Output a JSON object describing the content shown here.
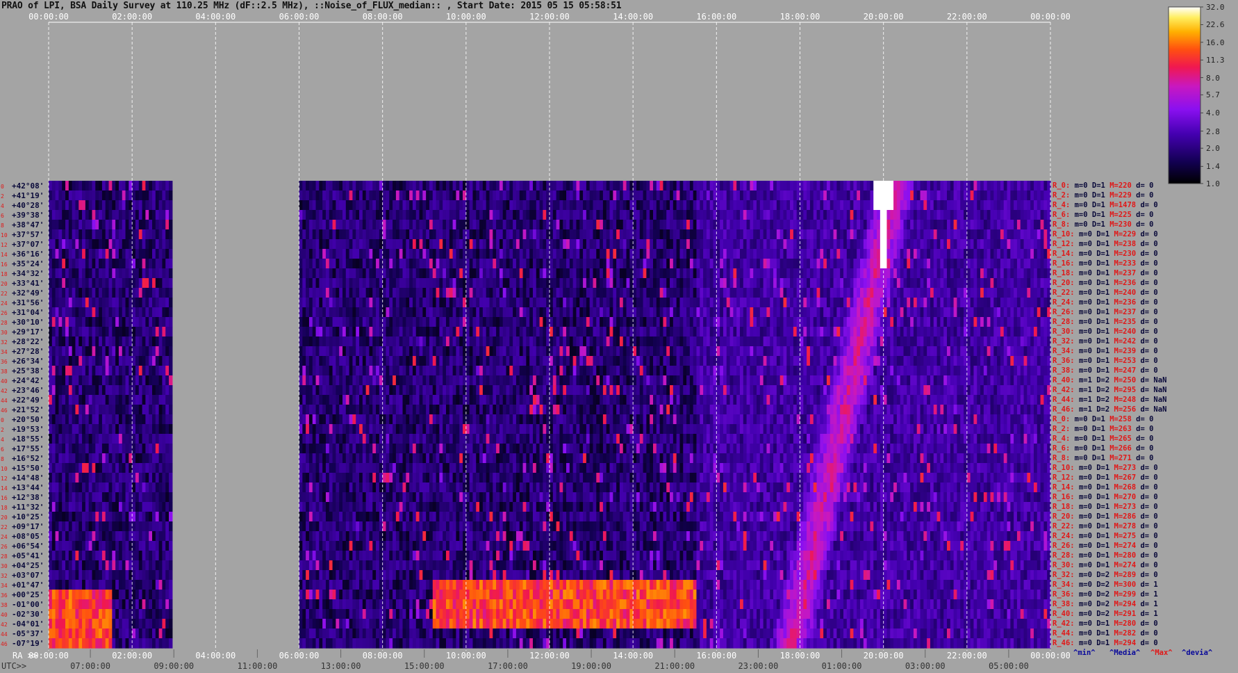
{
  "page": {
    "title": "PRAO of LPI, BSA Daily Survey at 110.25 MHz (dF::2.5 MHz), ::Noise_of_FLUX_median:: , Start Date: 2015 05 15 05:58:51"
  },
  "chart_data": {
    "type": "heatmap",
    "x_axis_top": {
      "label": "",
      "ticks": [
        "00:00:00",
        "02:00:00",
        "04:00:00",
        "06:00:00",
        "08:00:00",
        "10:00:00",
        "12:00:00",
        "14:00:00",
        "16:00:00",
        "18:00:00",
        "20:00:00",
        "22:00:00",
        "00:00:00"
      ]
    },
    "x_axis_ra": {
      "label": "RA >>",
      "ticks": [
        "00:00:00",
        "02:00:00",
        "04:00:00",
        "06:00:00",
        "08:00:00",
        "10:00:00",
        "12:00:00",
        "14:00:00",
        "16:00:00",
        "18:00:00",
        "20:00:00",
        "22:00:00",
        "00:00:00"
      ]
    },
    "x_axis_utc": {
      "label": "UTC>>",
      "ticks": [
        "07:00:00",
        "09:00:00",
        "11:00:00",
        "13:00:00",
        "15:00:00",
        "17:00:00",
        "19:00:00",
        "21:00:00",
        "23:00:00",
        "01:00:00",
        "03:00:00",
        "05:00:00"
      ]
    },
    "y_axis": {
      "declinations": [
        "+42°08'",
        "+41°19'",
        "+40°28'",
        "+39°38'",
        "+38°47'",
        "+37°57'",
        "+37°07'",
        "+36°16'",
        "+35°24'",
        "+34°32'",
        "+33°41'",
        "+32°49'",
        "+31°56'",
        "+31°04'",
        "+30°10'",
        "+29°17'",
        "+28°22'",
        "+27°28'",
        "+26°34'",
        "+25°38'",
        "+24°42'",
        "+23°46'",
        "+22°49'",
        "+21°52'",
        "+20°50'",
        "+19°53'",
        "+18°55'",
        "+17°55'",
        "+16°52'",
        "+15°50'",
        "+14°48'",
        "+13°44'",
        "+12°38'",
        "+11°32'",
        "+10°25'",
        "+09°17'",
        "+08°05'",
        "+06°54'",
        "+05°41'",
        "+04°25'",
        "+03°07'",
        "+01°47'",
        "+00°25'",
        "-01°00'",
        "-02°30'",
        "-04°01'",
        "-05°37'",
        "-07°19'"
      ],
      "beam_indices": [
        "0",
        "2",
        "4",
        "6",
        "8",
        "10",
        "12",
        "14",
        "16",
        "18",
        "20",
        "22",
        "24",
        "26",
        "28",
        "30",
        "32",
        "34",
        "36",
        "38",
        "40",
        "42",
        "44",
        "46",
        "0",
        "2",
        "4",
        "6",
        "8",
        "10",
        "12",
        "14",
        "16",
        "18",
        "20",
        "22",
        "24",
        "26",
        "28",
        "30",
        "32",
        "34",
        "36",
        "38",
        "40",
        "42",
        "44",
        "46"
      ]
    },
    "row_stats": [
      {
        "r": "R_0:",
        "m": "m=0",
        "D": "D=1",
        "M": "M=220",
        "d": "d= 0"
      },
      {
        "r": "R_2:",
        "m": "m=0",
        "D": "D=1",
        "M": "M=229",
        "d": "d= 0"
      },
      {
        "r": "R_4:",
        "m": "m=0",
        "D": "D=1",
        "M": "M=1478",
        "d": "d= 0"
      },
      {
        "r": "R_6:",
        "m": "m=0",
        "D": "D=1",
        "M": "M=225",
        "d": "d= 0"
      },
      {
        "r": "R_8:",
        "m": "m=0",
        "D": "D=1",
        "M": "M=230",
        "d": "d= 0"
      },
      {
        "r": "R_10:",
        "m": "m=0",
        "D": "D=1",
        "M": "M=229",
        "d": "d= 0"
      },
      {
        "r": "R_12:",
        "m": "m=0",
        "D": "D=1",
        "M": "M=238",
        "d": "d= 0"
      },
      {
        "r": "R_14:",
        "m": "m=0",
        "D": "D=1",
        "M": "M=230",
        "d": "d= 0"
      },
      {
        "r": "R_16:",
        "m": "m=0",
        "D": "D=1",
        "M": "M=233",
        "d": "d= 0"
      },
      {
        "r": "R_18:",
        "m": "m=0",
        "D": "D=1",
        "M": "M=237",
        "d": "d= 0"
      },
      {
        "r": "R_20:",
        "m": "m=0",
        "D": "D=1",
        "M": "M=236",
        "d": "d= 0"
      },
      {
        "r": "R_22:",
        "m": "m=0",
        "D": "D=1",
        "M": "M=240",
        "d": "d= 0"
      },
      {
        "r": "R_24:",
        "m": "m=0",
        "D": "D=1",
        "M": "M=236",
        "d": "d= 0"
      },
      {
        "r": "R_26:",
        "m": "m=0",
        "D": "D=1",
        "M": "M=237",
        "d": "d= 0"
      },
      {
        "r": "R_28:",
        "m": "m=0",
        "D": "D=1",
        "M": "M=235",
        "d": "d= 0"
      },
      {
        "r": "R_30:",
        "m": "m=0",
        "D": "D=1",
        "M": "M=240",
        "d": "d= 0"
      },
      {
        "r": "R_32:",
        "m": "m=0",
        "D": "D=1",
        "M": "M=242",
        "d": "d= 0"
      },
      {
        "r": "R_34:",
        "m": "m=0",
        "D": "D=1",
        "M": "M=239",
        "d": "d= 0"
      },
      {
        "r": "R_36:",
        "m": "m=0",
        "D": "D=1",
        "M": "M=253",
        "d": "d= 0"
      },
      {
        "r": "R_38:",
        "m": "m=0",
        "D": "D=1",
        "M": "M=247",
        "d": "d= 0"
      },
      {
        "r": "R_40:",
        "m": "m=1",
        "D": "D=2",
        "M": "M=250",
        "d": "d= NaN"
      },
      {
        "r": "R_42:",
        "m": "m=1",
        "D": "D=2",
        "M": "M=295",
        "d": "d= NaN"
      },
      {
        "r": "R_44:",
        "m": "m=1",
        "D": "D=2",
        "M": "M=248",
        "d": "d= NaN"
      },
      {
        "r": "R_46:",
        "m": "m=1",
        "D": "D=2",
        "M": "M=256",
        "d": "d= NaN"
      },
      {
        "r": "R_0:",
        "m": "m=0",
        "D": "D=1",
        "M": "M=258",
        "d": "d= 0"
      },
      {
        "r": "R_2:",
        "m": "m=0",
        "D": "D=1",
        "M": "M=263",
        "d": "d= 0"
      },
      {
        "r": "R_4:",
        "m": "m=0",
        "D": "D=1",
        "M": "M=265",
        "d": "d= 0"
      },
      {
        "r": "R_6:",
        "m": "m=0",
        "D": "D=1",
        "M": "M=266",
        "d": "d= 0"
      },
      {
        "r": "R_8:",
        "m": "m=0",
        "D": "D=1",
        "M": "M=271",
        "d": "d= 0"
      },
      {
        "r": "R_10:",
        "m": "m=0",
        "D": "D=1",
        "M": "M=273",
        "d": "d= 0"
      },
      {
        "r": "R_12:",
        "m": "m=0",
        "D": "D=1",
        "M": "M=267",
        "d": "d= 0"
      },
      {
        "r": "R_14:",
        "m": "m=0",
        "D": "D=1",
        "M": "M=268",
        "d": "d= 0"
      },
      {
        "r": "R_16:",
        "m": "m=0",
        "D": "D=1",
        "M": "M=270",
        "d": "d= 0"
      },
      {
        "r": "R_18:",
        "m": "m=0",
        "D": "D=1",
        "M": "M=273",
        "d": "d= 0"
      },
      {
        "r": "R_20:",
        "m": "m=0",
        "D": "D=1",
        "M": "M=286",
        "d": "d= 0"
      },
      {
        "r": "R_22:",
        "m": "m=0",
        "D": "D=1",
        "M": "M=278",
        "d": "d= 0"
      },
      {
        "r": "R_24:",
        "m": "m=0",
        "D": "D=1",
        "M": "M=275",
        "d": "d= 0"
      },
      {
        "r": "R_26:",
        "m": "m=0",
        "D": "D=1",
        "M": "M=274",
        "d": "d= 0"
      },
      {
        "r": "R_28:",
        "m": "m=0",
        "D": "D=1",
        "M": "M=280",
        "d": "d= 0"
      },
      {
        "r": "R_30:",
        "m": "m=0",
        "D": "D=1",
        "M": "M=274",
        "d": "d= 0"
      },
      {
        "r": "R_32:",
        "m": "m=0",
        "D": "D=2",
        "M": "M=289",
        "d": "d= 0"
      },
      {
        "r": "R_34:",
        "m": "m=0",
        "D": "D=2",
        "M": "M=300",
        "d": "d= 1"
      },
      {
        "r": "R_36:",
        "m": "m=0",
        "D": "D=2",
        "M": "M=299",
        "d": "d= 1"
      },
      {
        "r": "R_38:",
        "m": "m=0",
        "D": "D=2",
        "M": "M=294",
        "d": "d= 1"
      },
      {
        "r": "R_40:",
        "m": "m=0",
        "D": "D=2",
        "M": "M=291",
        "d": "d= 1"
      },
      {
        "r": "R_42:",
        "m": "m=0",
        "D": "D=1",
        "M": "M=280",
        "d": "d= 0"
      },
      {
        "r": "R_44:",
        "m": "m=0",
        "D": "D=1",
        "M": "M=282",
        "d": "d= 0"
      },
      {
        "r": "R_46:",
        "m": "m=0",
        "D": "D=1",
        "M": "M=294",
        "d": "d= 0"
      }
    ],
    "stat_legend": {
      "min": "^min^",
      "median": "^Media^",
      "max": "^Max^",
      "devia": "^devia^"
    },
    "colorbar": {
      "ticks": [
        "32.0",
        "22.6",
        "16.0",
        "11.3",
        "8.0",
        "5.7",
        "4.0",
        "2.8",
        "2.0",
        "1.4",
        "1.0"
      ],
      "scale": "log",
      "range": [
        1.0,
        32.0
      ]
    },
    "data_gaps_ra_hours": [
      [
        3.0,
        6.0
      ]
    ],
    "features": [
      {
        "label": "",
        "kind": "hot-band",
        "ra_start": 9.2,
        "ra_end": 15.5,
        "rows": [
          41,
          45
        ],
        "level": 16.0
      },
      {
        "label": "",
        "kind": "hot-band",
        "ra_start": 0.0,
        "ra_end": 1.5,
        "rows": [
          42,
          47
        ],
        "level": 16.0
      },
      {
        "label": "",
        "kind": "diagonal-source",
        "ra_start": 17.8,
        "ra_end": 20.3,
        "rows": [
          0,
          47
        ],
        "level": 8.0
      },
      {
        "label": "",
        "kind": "point-source",
        "ra": 20.0,
        "row": 1,
        "level": 32.0
      }
    ]
  }
}
